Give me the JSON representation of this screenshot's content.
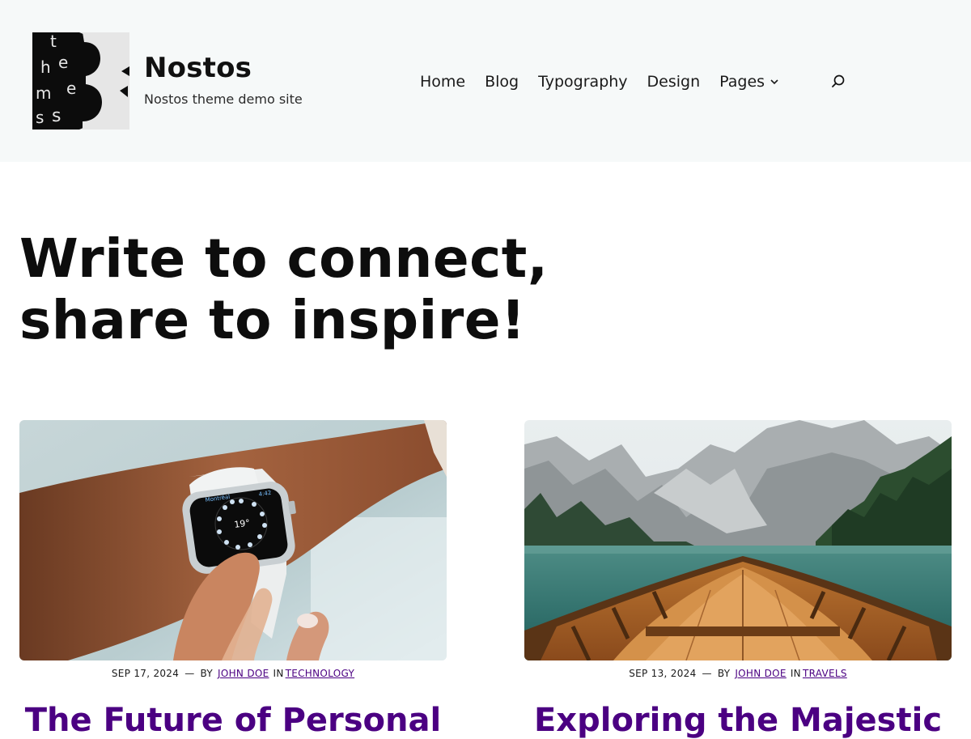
{
  "header": {
    "site_title": "Nostos",
    "tagline": "Nostos theme demo site",
    "logo_letters": [
      "t",
      "h",
      "e",
      "m",
      "e",
      "s",
      "3"
    ],
    "nav": [
      {
        "label": "Home"
      },
      {
        "label": "Blog"
      },
      {
        "label": "Typography"
      },
      {
        "label": "Design"
      },
      {
        "label": "Pages",
        "has_submenu": true
      }
    ],
    "search_icon": "search-icon"
  },
  "hero": {
    "title": "Write to connect, share to inspire!"
  },
  "posts": [
    {
      "date": "SEP 17, 2024",
      "separator": "—",
      "by_label": "BY",
      "author": "JOHN DOE",
      "in_label": "IN",
      "category": "TECHNOLOGY",
      "title": "The Future of Personal",
      "image_subject": "smartwatch on wrist",
      "watch_city": "Montréal",
      "watch_time": "4:42",
      "watch_temp": "19°"
    },
    {
      "date": "SEP 13, 2024",
      "separator": "—",
      "by_label": "BY",
      "author": "JOHN DOE",
      "in_label": "IN",
      "category": "TRAVELS",
      "title": "Exploring the Majestic",
      "image_subject": "wooden boat on mountain lake"
    }
  ],
  "colors": {
    "header_bg": "#f6f9f9",
    "link": "#4b0082",
    "post_title": "#4b0082",
    "text": "#111111"
  }
}
